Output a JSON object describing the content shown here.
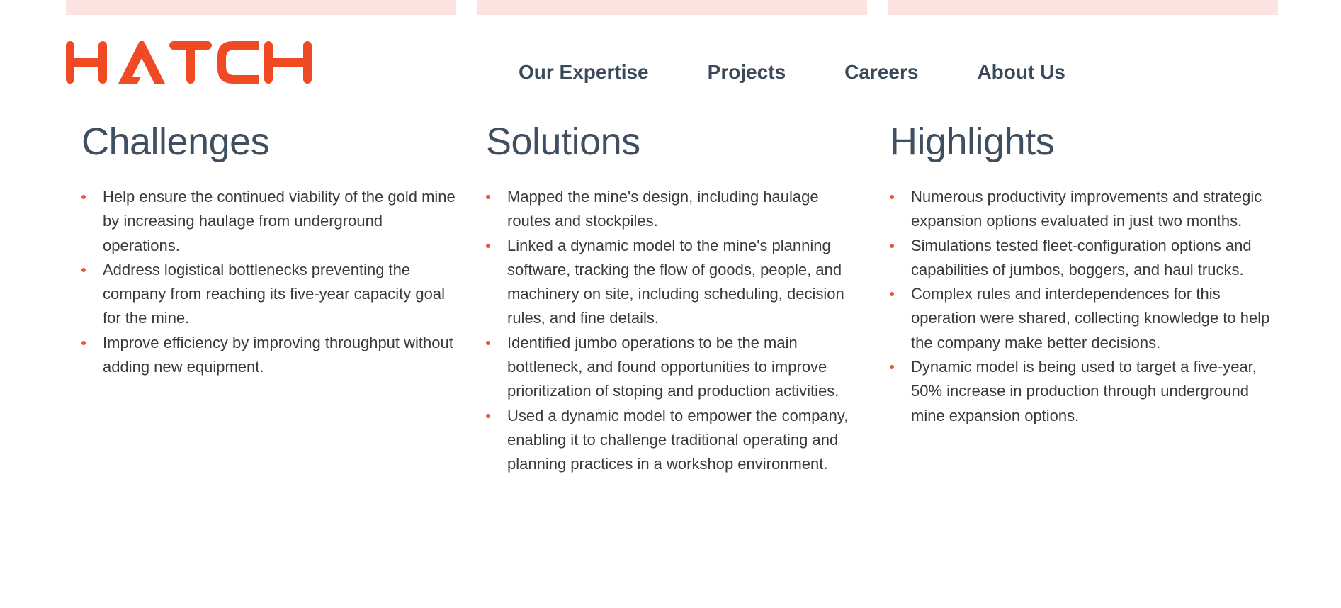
{
  "brand": {
    "logo_text": "HATCH",
    "logo_color": "#f04a24"
  },
  "colors": {
    "top_bar": "#fce3e0",
    "heading": "#3f4f60",
    "nav_text": "#3b4a5a",
    "body_text": "#3a3a3a",
    "bullet": "#e8553d"
  },
  "nav": {
    "items": [
      {
        "label": "Our Expertise"
      },
      {
        "label": "Projects"
      },
      {
        "label": "Careers"
      },
      {
        "label": "About Us"
      }
    ]
  },
  "sections": [
    {
      "title": "Challenges",
      "items": [
        "Help ensure the continued viability of the gold mine by increasing haulage from underground operations.",
        "Address logistical bottlenecks preventing the company from reaching its five-year capacity goal for the mine.",
        "Improve efficiency by improving throughput without adding new equipment."
      ]
    },
    {
      "title": "Solutions",
      "items": [
        "Mapped the mine's design, including haulage routes and stockpiles.",
        "Linked a dynamic model to the mine's planning software, tracking the flow of goods, people, and machinery on site, including scheduling, decision rules, and fine details.",
        "Identified jumbo operations to be the main bottleneck, and found opportunities to improve prioritization of stoping and production activities.",
        "Used a dynamic model to empower the company, enabling it to challenge traditional operating and planning practices in a workshop environment."
      ]
    },
    {
      "title": "Highlights",
      "items": [
        "Numerous productivity improvements and strategic expansion options evaluated in just two months.",
        "Simulations tested fleet-configuration options and capabilities of jumbos, boggers, and haul trucks.",
        "Complex rules and interdependences for this operation were shared, collecting knowledge to help the company make better decisions.",
        "Dynamic model is being used to target a five-year, 50% increase in production through underground mine expansion options."
      ]
    }
  ]
}
